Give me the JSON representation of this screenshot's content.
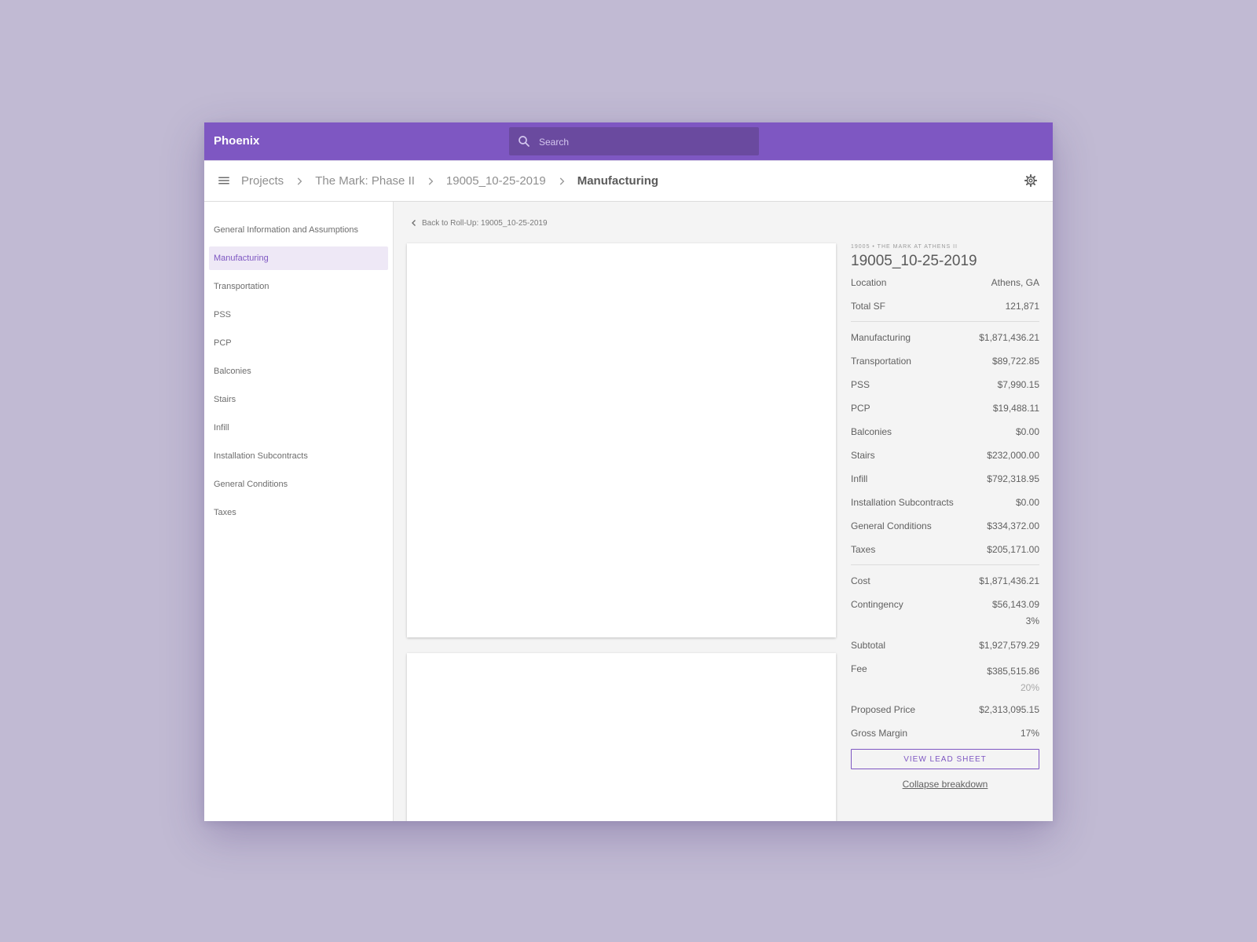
{
  "app": {
    "title": "Phoenix"
  },
  "search": {
    "placeholder": "Search",
    "icon": "search-icon"
  },
  "breadcrumb": {
    "items": [
      "Projects",
      "The Mark: Phase II",
      "19005_10-25-2019"
    ],
    "current": "Manufacturing"
  },
  "sidebar": {
    "items": [
      "General Information and Assumptions",
      "Manufacturing",
      "Transportation",
      "PSS",
      "PCP",
      "Balconies",
      "Stairs",
      "Infill",
      "Installation Subcontracts",
      "General Conditions",
      "Taxes"
    ],
    "active": "Manufacturing"
  },
  "main": {
    "back_label": "Back to Roll-Up: 19005_10-25-2019"
  },
  "summary": {
    "kicker": "19005 • THE MARK AT ATHENS II",
    "title": "19005_10-25-2019",
    "info": [
      {
        "label": "Location",
        "value": "Athens, GA"
      },
      {
        "label": "Total SF",
        "value": "121,871"
      }
    ],
    "breakdown": [
      {
        "label": "Manufacturing",
        "value": "$1,871,436.21"
      },
      {
        "label": "Transportation",
        "value": "$89,722.85"
      },
      {
        "label": "PSS",
        "value": "$7,990.15"
      },
      {
        "label": "PCP",
        "value": "$19,488.11"
      },
      {
        "label": "Balconies",
        "value": "$0.00"
      },
      {
        "label": "Stairs",
        "value": "$232,000.00"
      },
      {
        "label": "Infill",
        "value": "$792,318.95"
      },
      {
        "label": "Installation Subcontracts",
        "value": "$0.00"
      },
      {
        "label": "General Conditions",
        "value": "$334,372.00"
      },
      {
        "label": "Taxes",
        "value": "$205,171.00"
      }
    ],
    "cost": {
      "label": "Cost",
      "value": "$1,871,436.21"
    },
    "contingency": {
      "label": "Contingency",
      "value": "$56,143.09",
      "percent": "3%"
    },
    "subtotal": {
      "label": "Subtotal",
      "value": "$1,927,579.29"
    },
    "fee": {
      "label": "Fee",
      "value": "$385,515.86",
      "percent": "20%"
    },
    "proposed_price": {
      "label": "Proposed Price",
      "value": "$2,313,095.15"
    },
    "gross_margin": {
      "label": "Gross Margin",
      "value": "17%"
    },
    "view_button": "VIEW LEAD SHEET",
    "collapse_link": "Collapse breakdown"
  },
  "colors": {
    "accent": "#7e57c2",
    "background": "#c1bad3",
    "active_item_bg": "#eee8f6"
  }
}
